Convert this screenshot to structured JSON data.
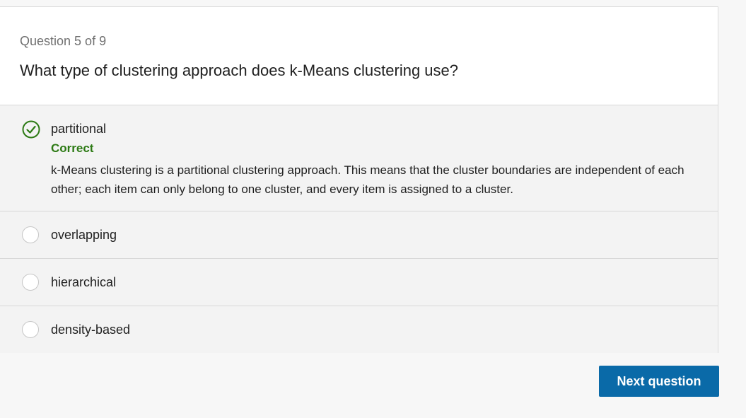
{
  "question": {
    "counter": "Question 5 of 9",
    "text": "What type of clustering approach does k-Means clustering use?"
  },
  "options": [
    {
      "label": "partitional",
      "selected": true,
      "status": "Correct",
      "explanation": "k-Means clustering is a partitional clustering approach. This means that the cluster boundaries are independent of each other; each item can only belong to one cluster, and every item is assigned to a cluster."
    },
    {
      "label": "overlapping",
      "selected": false
    },
    {
      "label": "hierarchical",
      "selected": false
    },
    {
      "label": "density-based",
      "selected": false
    }
  ],
  "actions": {
    "next_label": "Next question"
  },
  "colors": {
    "correct": "#2c7a14",
    "button": "#0a6aa8"
  },
  "icons": {
    "correct_mark": "check-circle-icon",
    "unselected_mark": "radio-empty-icon"
  }
}
